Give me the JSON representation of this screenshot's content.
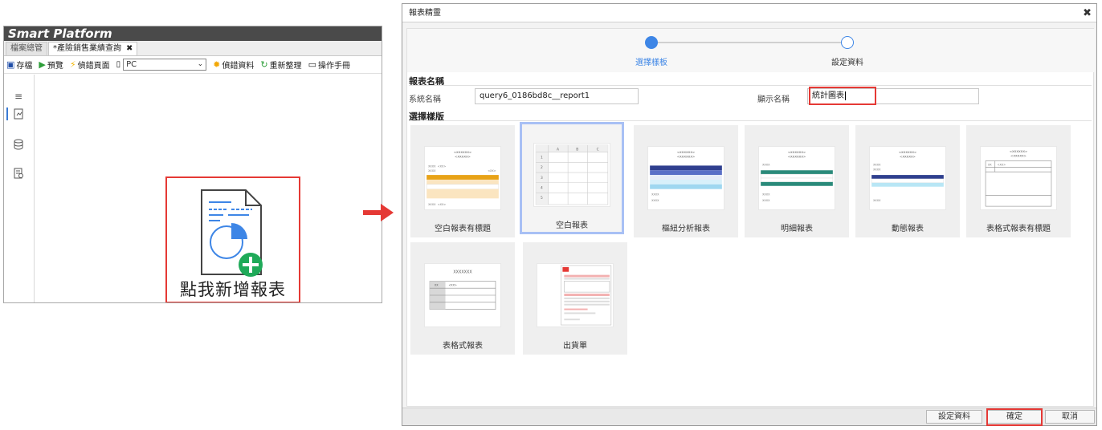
{
  "left_panel": {
    "brand": "Smart Platform",
    "tabs": [
      {
        "label": "檔案總管",
        "active": false
      },
      {
        "label": "*產險銷售業績查詢",
        "active": true,
        "close": "✖"
      }
    ],
    "toolbar": {
      "save": "存檔",
      "preview": "預覽",
      "debug_page": "偵錯頁面",
      "device_value": "PC",
      "debug_data": "偵錯資料",
      "reorganize": "重新整理",
      "manual": "操作手冊"
    },
    "cta_label": "點我新增報表"
  },
  "dialog": {
    "title": "報表精靈",
    "close": "✖",
    "steps": [
      {
        "label": "選擇樣板",
        "active": true
      },
      {
        "label": "設定資料",
        "active": false
      }
    ],
    "section_report_name": "報表名稱",
    "system_name_label": "系統名稱",
    "system_name_value": "query6_0186bd8c__report1",
    "display_name_label": "顯示名稱",
    "display_name_value": "統計圖表",
    "section_template": "選擇樣版",
    "templates": [
      {
        "label": "空白報表有標題",
        "selected": false
      },
      {
        "label": "空白報表",
        "selected": true
      },
      {
        "label": "樞紐分析報表",
        "selected": false
      },
      {
        "label": "明細報表",
        "selected": false
      },
      {
        "label": "動態報表",
        "selected": false
      },
      {
        "label": "表格式報表有標題",
        "selected": false
      },
      {
        "label": "表格式報表",
        "selected": false
      },
      {
        "label": "出貨單",
        "selected": false
      }
    ],
    "thumb_text": {
      "x6": "<XXXXXX>",
      "x5": "<XXXXX>",
      "xxxx": "XXXX",
      "xx_short": "<XX>",
      "xx": "XX",
      "xxxxxxx": "XXXXXXX",
      "cols": [
        "A",
        "B",
        "C"
      ],
      "rows": [
        "1",
        "2",
        "3",
        "4",
        "5"
      ]
    },
    "footer": {
      "set_data": "設定資料",
      "ok": "確定",
      "cancel": "取消"
    }
  },
  "colors": {
    "accent_blue": "#3e86e6",
    "highlight_red": "#e53935",
    "selected_border": "#a8c0f5",
    "add_green": "#1faa59"
  }
}
